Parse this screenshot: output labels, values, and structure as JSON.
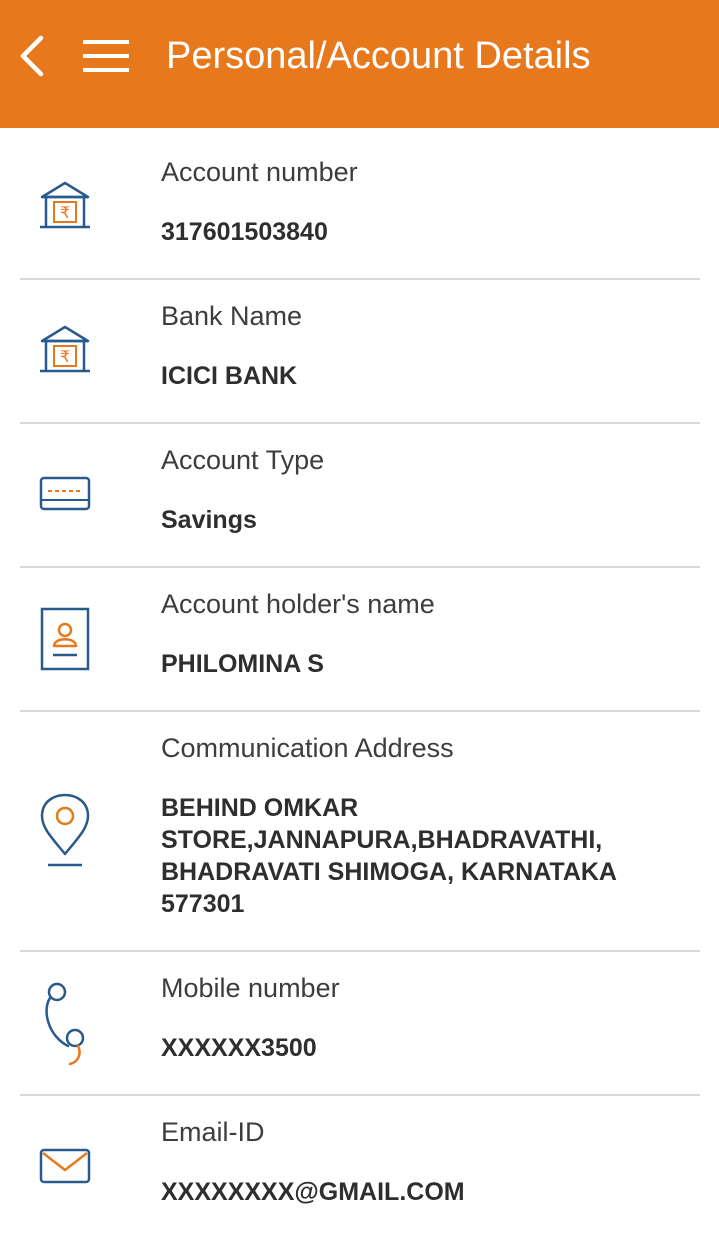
{
  "header": {
    "title": "Personal/Account Details",
    "back_icon": "back-arrow-icon",
    "menu_icon": "hamburger-menu-icon"
  },
  "colors": {
    "header_bg": "#e8781c",
    "icon_blue": "#2a5a8c",
    "icon_orange": "#e8781c"
  },
  "details": [
    {
      "label": "Account number",
      "value": "317601503840",
      "icon": "bank-rupee-icon"
    },
    {
      "label": "Bank Name",
      "value": "ICICI BANK",
      "icon": "bank-rupee-icon"
    },
    {
      "label": "Account Type",
      "value": "Savings",
      "icon": "card-icon"
    },
    {
      "label": "Account holder's name",
      "value": "PHILOMINA S",
      "icon": "id-badge-icon"
    },
    {
      "label": "Communication Address",
      "value": "BEHIND OMKAR STORE,JANNAPURA,BHADRAVATHI, BHADRAVATI SHIMOGA, KARNATAKA 577301",
      "icon": "location-pin-icon"
    },
    {
      "label": "Mobile number",
      "value": "XXXXXX3500",
      "icon": "phone-icon"
    },
    {
      "label": "Email-ID",
      "value": "XXXXXXXX@GMAIL.COM",
      "icon": "mail-icon"
    }
  ]
}
